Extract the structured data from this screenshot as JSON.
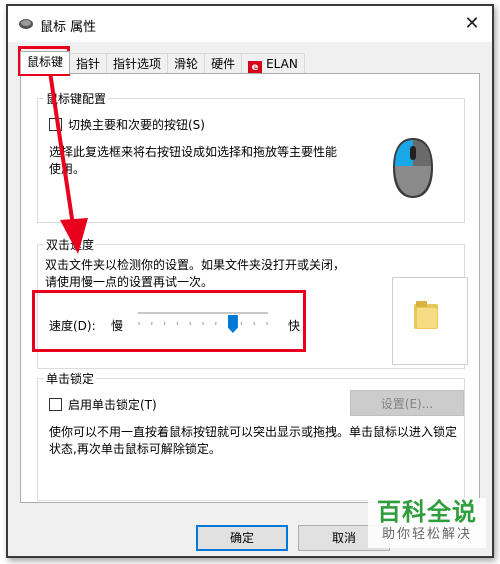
{
  "window": {
    "title": "鼠标 属性",
    "close_glyph": "✕"
  },
  "tabs": [
    {
      "label": "鼠标键"
    },
    {
      "label": "指针"
    },
    {
      "label": "指针选项"
    },
    {
      "label": "滑轮"
    },
    {
      "label": "硬件"
    },
    {
      "label": "ELAN"
    }
  ],
  "button_config": {
    "group_title": "鼠标键配置",
    "checkbox_label": "切换主要和次要的按钮(S)",
    "checked": false,
    "description": "选择此复选框来将右按钮设成如选择和拖放等主要性能使用。"
  },
  "double_click": {
    "group_title": "双击速度",
    "description": "双击文件夹以检测你的设置。如果文件夹没打开或关闭，请使用慢一点的设置再试一次。",
    "speed_label": "速度(D):",
    "slow_label": "慢",
    "fast_label": "快",
    "speed_fraction": 0.73
  },
  "click_lock": {
    "group_title": "单击锁定",
    "checkbox_label": "启用单击锁定(T)",
    "checked": false,
    "settings_button": "设置(E)...",
    "description": "使你可以不用一直按着鼠标按钮就可以突出显示或拖拽。单击鼠标以进入锁定状态,再次单击鼠标可解除锁定。"
  },
  "footer": {
    "ok_label": "确定",
    "cancel_label": "取消"
  },
  "watermark": {
    "main": "百科全说",
    "sub": "助你轻松解决"
  },
  "colors": {
    "accent": "#0078d7",
    "annotation_red": "#e8001c",
    "watermark_green": "#2e9d3b"
  }
}
